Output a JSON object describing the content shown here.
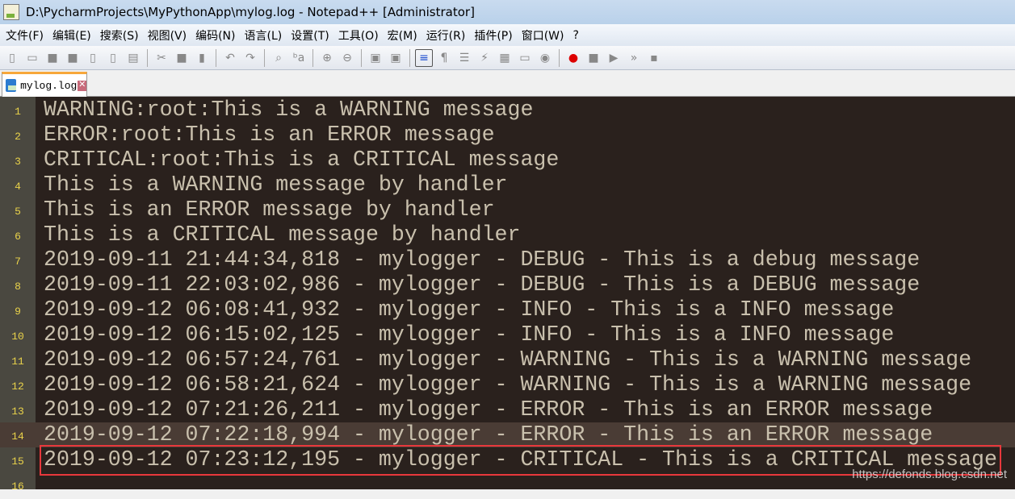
{
  "window": {
    "title": "D:\\PycharmProjects\\MyPythonApp\\mylog.log - Notepad++ [Administrator]"
  },
  "menu": [
    "文件(F)",
    "编辑(E)",
    "搜索(S)",
    "视图(V)",
    "编码(N)",
    "语言(L)",
    "设置(T)",
    "工具(O)",
    "宏(M)",
    "运行(R)",
    "插件(P)",
    "窗口(W)",
    "?"
  ],
  "toolbar": [
    "new-file",
    "open-file",
    "save",
    "save-all",
    "close",
    "close-all",
    "print",
    "|",
    "cut",
    "copy",
    "paste",
    "|",
    "undo",
    "redo",
    "|",
    "find",
    "replace",
    "|",
    "zoom-in",
    "zoom-out",
    "|",
    "sync-vertical",
    "sync-horizontal",
    "|",
    "word-wrap",
    "show-all-chars",
    "indent-guide",
    "user-language",
    "function-list",
    "folder-workspace",
    "document-map",
    "|",
    "record-macro",
    "stop-record",
    "play-macro",
    "run-macro-multiple",
    "save-macro"
  ],
  "tab": {
    "label": "mylog.log"
  },
  "editor": {
    "current_line": 14,
    "highlighted_line": 15,
    "lines": [
      "WARNING:root:This is a WARNING message",
      "ERROR:root:This is an ERROR message",
      "CRITICAL:root:This is a CRITICAL message",
      "This is a WARNING message by handler",
      "This is an ERROR message by handler",
      "This is a CRITICAL message by handler",
      "2019-09-11 21:44:34,818 - mylogger - DEBUG - This is a debug message",
      "2019-09-11 22:03:02,986 - mylogger - DEBUG - This is a DEBUG message",
      "2019-09-12 06:08:41,932 - mylogger - INFO - This is a INFO message",
      "2019-09-12 06:15:02,125 - mylogger - INFO - This is a INFO message",
      "2019-09-12 06:57:24,761 - mylogger - WARNING - This is a WARNING message",
      "2019-09-12 06:58:21,624 - mylogger - WARNING - This is a WARNING message",
      "2019-09-12 07:21:26,211 - mylogger - ERROR - This is an ERROR message",
      "2019-09-12 07:22:18,994 - mylogger - ERROR - This is an ERROR message",
      "2019-09-12 07:23:12,195 - mylogger - CRITICAL - This is a CRITICAL message",
      ""
    ]
  },
  "watermark": "https://defonds.blog.csdn.net",
  "colors": {
    "editor_bg": "#2a211d",
    "line_number": "#e9d24a",
    "text": "#c9c0ad",
    "current_line": "#4a3c35",
    "highlight_box": "#e8383c",
    "tab_accent": "#f7a73a"
  }
}
